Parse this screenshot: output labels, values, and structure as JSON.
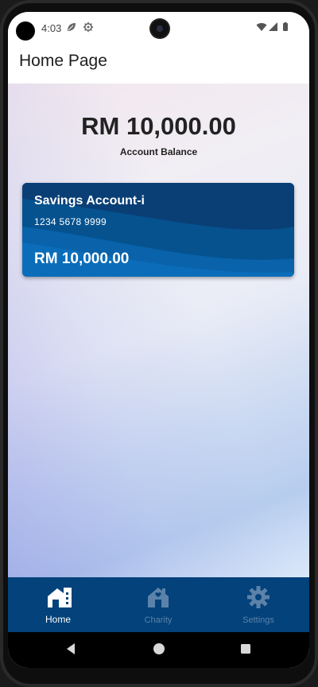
{
  "status_bar": {
    "time": "4:03"
  },
  "app_bar": {
    "title": "Home Page"
  },
  "balance": {
    "amount": "RM 10,000.00",
    "label": "Account Balance"
  },
  "account_card": {
    "name": "Savings Account-i",
    "number": "1234 5678 9999",
    "balance": "RM 10,000.00"
  },
  "bottom_nav": {
    "active": "Home",
    "items": [
      {
        "label": "Home",
        "icon": "home-icon"
      },
      {
        "label": "Charity",
        "icon": "charity-house-icon"
      },
      {
        "label": "Settings",
        "icon": "gear-icon"
      }
    ]
  },
  "colors": {
    "nav_background": "#03427a",
    "card_background": "#05528f",
    "inactive_nav": "#5c82a9"
  }
}
